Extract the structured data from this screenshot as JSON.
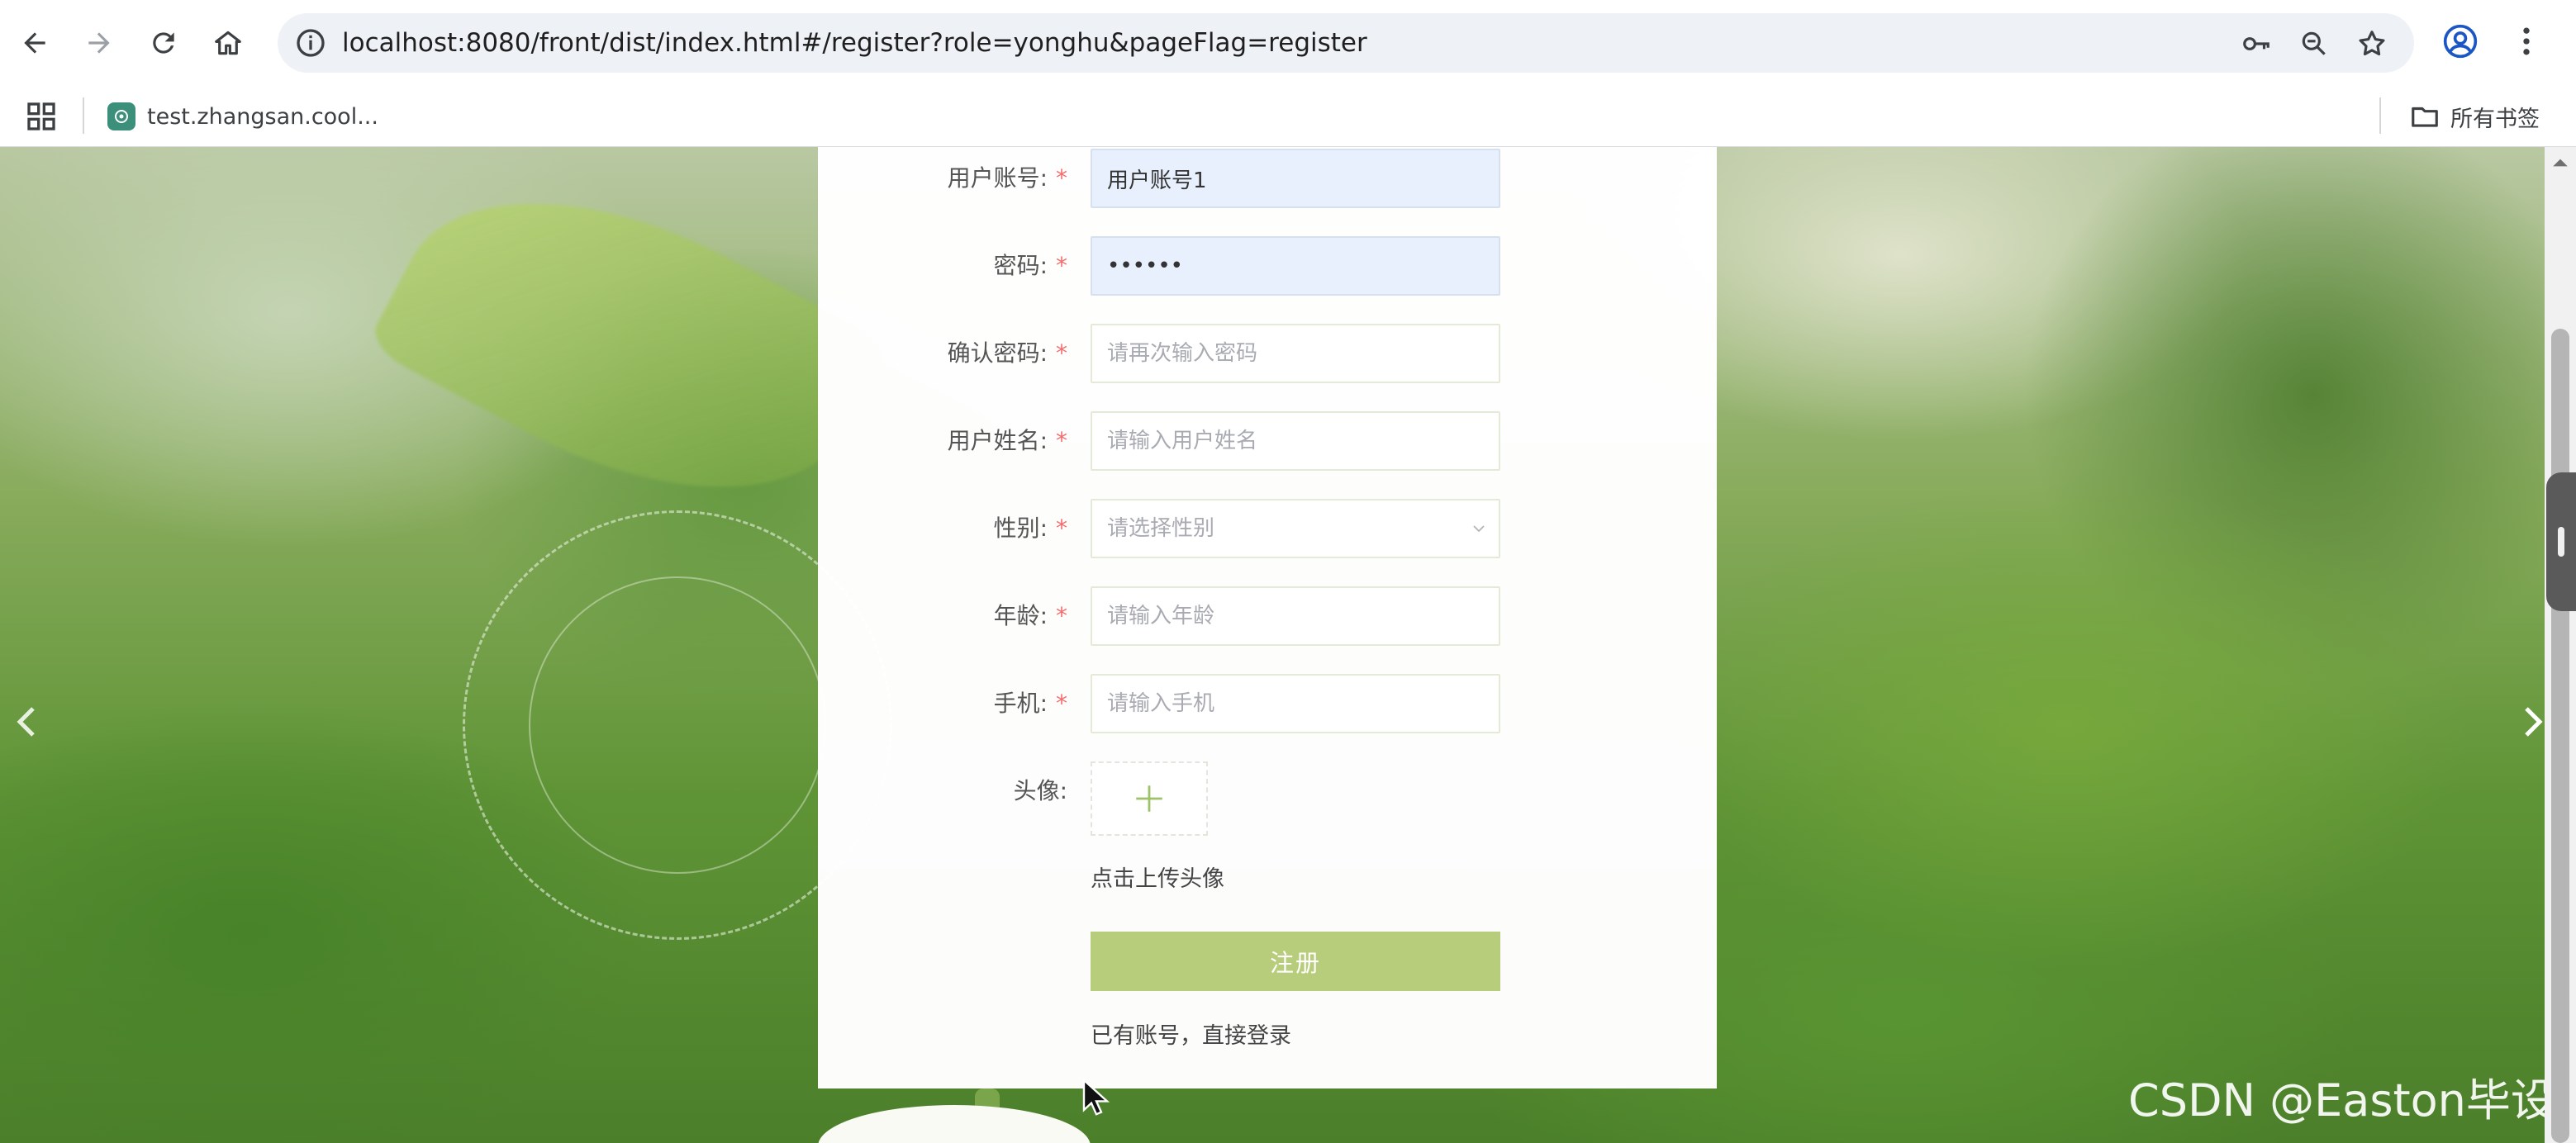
{
  "browser": {
    "url": "localhost:8080/front/dist/index.html#/register?role=yonghu&pageFlag=register",
    "bookmarks": [
      {
        "label": "test.zhangsan.cool..."
      }
    ],
    "all_bookmarks_label": "所有书签"
  },
  "form": {
    "fields": [
      {
        "label": "用户账号:",
        "value": "用户账号1",
        "placeholder": ""
      },
      {
        "label": "密码:",
        "value": "••••••",
        "placeholder": ""
      },
      {
        "label": "确认密码:",
        "value": "",
        "placeholder": "请再次输入密码"
      },
      {
        "label": "用户姓名:",
        "value": "",
        "placeholder": "请输入用户姓名"
      },
      {
        "label": "性别:",
        "value": "",
        "placeholder": "请选择性别"
      },
      {
        "label": "年龄:",
        "value": "",
        "placeholder": "请输入年龄"
      },
      {
        "label": "手机:",
        "value": "",
        "placeholder": "请输入手机"
      }
    ],
    "required_mark": "*",
    "avatar_label": "头像:",
    "upload_hint": "点击上传头像",
    "submit_label": "注册",
    "login_link": "已有账号，直接登录"
  },
  "watermark": "CSDN @Easton毕设",
  "colors": {
    "primary_button": "#b7cd7b",
    "required_star": "#f56c6c",
    "autofill_bg": "#e8f0fe"
  }
}
